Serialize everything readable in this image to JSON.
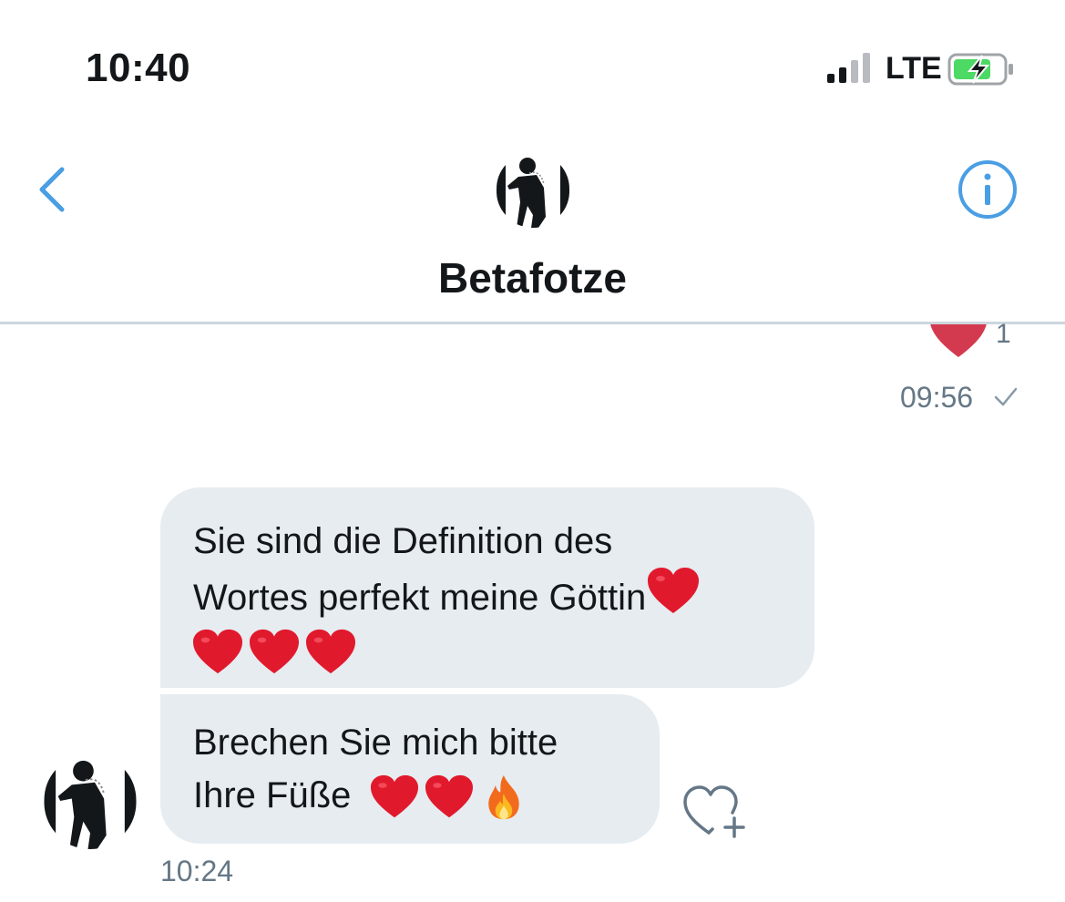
{
  "status_bar": {
    "time": "10:40",
    "carrier": "LTE",
    "signal_bars": 4,
    "signal_bars_active": 2,
    "battery_icon": "battery-charging-icon"
  },
  "header": {
    "back_icon": "chevron-left-icon",
    "avatar_icon": "person-silhouette-avatar-icon",
    "title": "Betafotze",
    "info_icon": "info-icon"
  },
  "conversation": {
    "previous_message": {
      "like_icon": "heart-filled-icon",
      "like_count": "1",
      "time": "09:56",
      "status_icon": "checkmark-icon"
    },
    "messages": [
      {
        "lines": [
          "Sie sind die Definition des",
          "Wortes perfekt meine Göttin"
        ],
        "emoji_line": [
          "red-heart-emoji",
          "red-heart-emoji",
          "red-heart-emoji"
        ]
      },
      {
        "lines": [
          "Brechen Sie mich bitte",
          "Ihre Füße"
        ],
        "trailing_emoji": [
          "red-heart-emoji",
          "red-heart-emoji",
          "fire-emoji"
        ]
      }
    ],
    "sender_avatar_icon": "person-silhouette-avatar-icon",
    "react_icon": "heart-plus-icon",
    "last_time": "10:24"
  },
  "colors": {
    "accent": "#4a9ee3",
    "bubble_bg": "#e6ecf0",
    "secondary_text": "#657786",
    "heart_red": "#e0245e",
    "divider": "#ccd6dd"
  }
}
